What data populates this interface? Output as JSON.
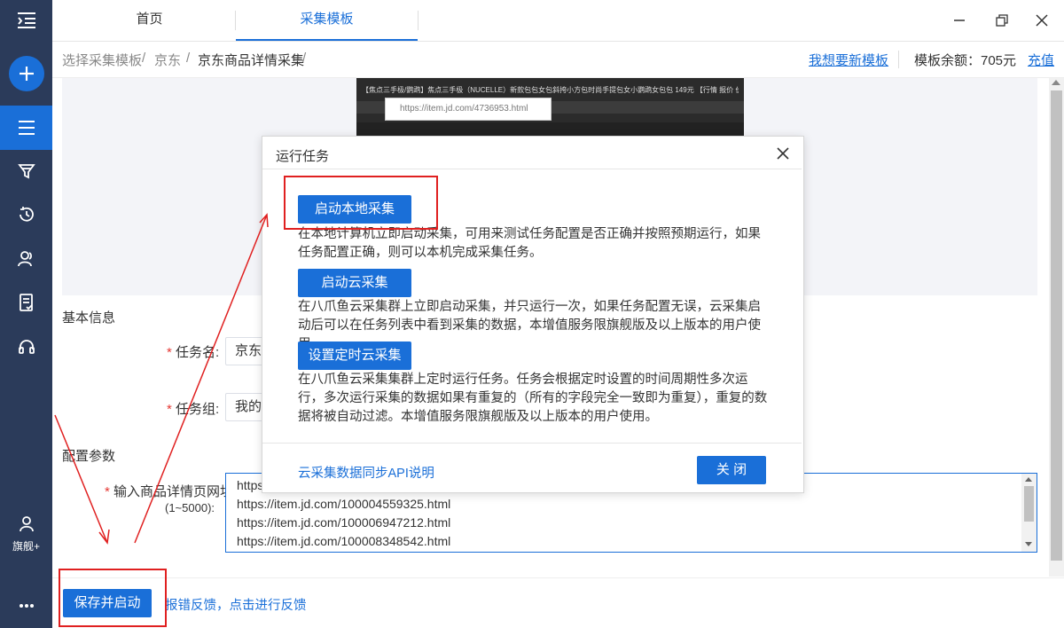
{
  "sidebar": {
    "menu_icon": "menu-collapse-icon",
    "new_icon": "plus-icon",
    "items": [
      {
        "icon": "list-icon",
        "active": true
      },
      {
        "icon": "filter-icon"
      },
      {
        "icon": "history-icon"
      },
      {
        "icon": "users-icon"
      },
      {
        "icon": "document-icon"
      },
      {
        "icon": "headset-icon"
      }
    ],
    "account_label": "旗舰+",
    "more_icon": "more-icon"
  },
  "tabs": [
    {
      "label": "首页"
    },
    {
      "label": "采集模板",
      "active": true
    }
  ],
  "breadcrumb": {
    "items": [
      "选择采集模板",
      "京东",
      "京东商品详情采集"
    ],
    "separator": "/"
  },
  "header_right": {
    "want_template_link": "我想要新模板",
    "balance_label": "模板余额：705元",
    "recharge_link": "充值"
  },
  "preview": {
    "page_title_text": "【焦点三手极/鹦鹉】焦点三手极（NUCELLE）新款包包女包斜挎小方包时尚手提包女小鹦鹉女包包 149元 【行情 报价 价格 评测】-京东",
    "url_text": "https://item.jd.com/4736953.html"
  },
  "basic_info": {
    "title": "基本信息",
    "task_name_label": "任务名:",
    "task_name_value": "京东",
    "task_group_label": "任务组:",
    "task_group_value": "我的"
  },
  "config": {
    "title": "配置参数",
    "url_label": "输入商品详情页网址",
    "url_hint": "(1~5000):",
    "urls": [
      "https",
      "https://item.jd.com/100004559325.html",
      "https://item.jd.com/100006947212.html",
      "https://item.jd.com/100008348542.html"
    ]
  },
  "footer": {
    "save_start_button": "保存并启动",
    "feedback_link": "报错反馈，点击进行反馈"
  },
  "dialog": {
    "title": "运行任务",
    "local_button": "启动本地采集",
    "local_desc": "在本地计算机立即启动采集，可用来测试任务配置是否正确并按照预期运行，如果任务配置正确，则可以本机完成采集任务。",
    "cloud_button": "启动云采集",
    "cloud_desc": "在八爪鱼云采集群上立即启动采集，并只运行一次，如果任务配置无误，云采集启动后可以在任务列表中看到采集的数据，本增值服务限旗舰版及以上版本的用户使用。",
    "schedule_button": "设置定时云采集",
    "schedule_desc": "在八爪鱼云采集集群上定时运行任务。任务会根据定时设置的时间周期性多次运行，多次运行采集的数据如果有重复的（所有的字段完全一致即为重复），重复的数据将被自动过滤。本增值服务限旗舰版及以上版本的用户使用。",
    "api_link": "云采集数据同步API说明",
    "close_button": "关 闭",
    "close_icon": "close-icon"
  },
  "colors": {
    "sidebar_bg": "#2b3b5a",
    "accent": "#1a6fd8",
    "annotation_red": "#e02020"
  }
}
